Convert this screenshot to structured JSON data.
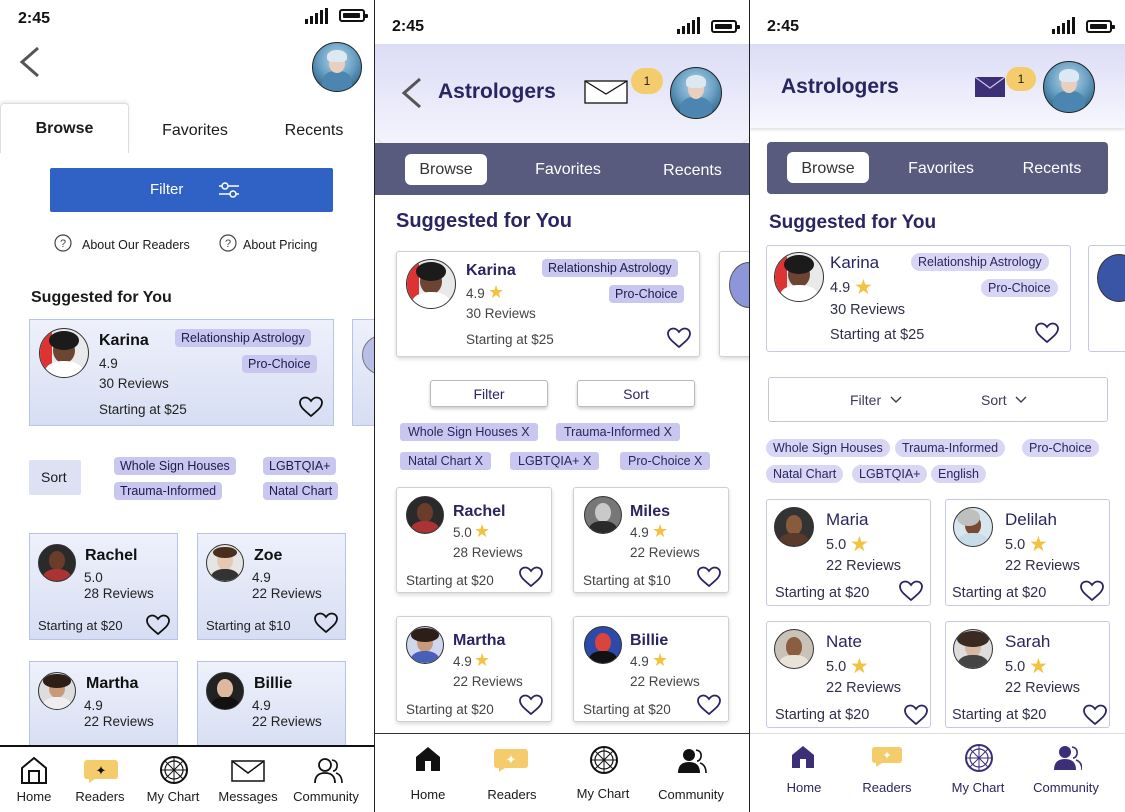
{
  "status": {
    "time": "2:45"
  },
  "screen1": {
    "tabs": [
      "Browse",
      "Favorites",
      "Recents"
    ],
    "filter_label": "Filter",
    "about_readers": "About Our Readers",
    "about_pricing": "About Pricing",
    "section_title": "Suggested for You",
    "featured": {
      "name": "Karina",
      "rating": "4.9",
      "reviews": "30 Reviews",
      "price": "Starting at $25",
      "tags": [
        "Relationship Astrology",
        "Pro-Choice"
      ]
    },
    "sort_label": "Sort",
    "filter_tags": [
      "Whole Sign Houses",
      "LGBTQIA+",
      "Trauma-Informed",
      "Natal Chart"
    ],
    "readers": [
      {
        "name": "Rachel",
        "rating": "5.0",
        "reviews": "28 Reviews",
        "price": "Starting at $20"
      },
      {
        "name": "Zoe",
        "rating": "4.9",
        "reviews": "22 Reviews",
        "price": "Starting at $10"
      },
      {
        "name": "Martha",
        "rating": "4.9",
        "reviews": "22 Reviews",
        "price": ""
      },
      {
        "name": "Billie",
        "rating": "4.9",
        "reviews": "22 Reviews",
        "price": ""
      }
    ],
    "nav": [
      "Home",
      "Readers",
      "My Chart",
      "Messages",
      "Community"
    ]
  },
  "screen2": {
    "title": "Astrologers",
    "badge": "1",
    "tabs": [
      "Browse",
      "Favorites",
      "Recents"
    ],
    "section_title": "Suggested for You",
    "featured": {
      "name": "Karina",
      "rating": "4.9",
      "reviews": "30 Reviews",
      "price": "Starting at $25",
      "tags": [
        "Relationship Astrology",
        "Pro-Choice"
      ]
    },
    "filter_label": "Filter",
    "sort_label": "Sort",
    "filter_tags": [
      "Whole Sign Houses  X",
      "Trauma-Informed  X",
      "Natal Chart  X",
      "LGBTQIA+  X",
      "Pro-Choice  X"
    ],
    "readers": [
      {
        "name": "Rachel",
        "rating": "5.0",
        "reviews": "28 Reviews",
        "price": "Starting at $20"
      },
      {
        "name": "Miles",
        "rating": "4.9",
        "reviews": "22 Reviews",
        "price": "Starting at $10"
      },
      {
        "name": "Martha",
        "rating": "4.9",
        "reviews": "22 Reviews",
        "price": "Starting at $20"
      },
      {
        "name": "Billie",
        "rating": "4.9",
        "reviews": "22 Reviews",
        "price": "Starting at $20"
      }
    ],
    "nav": [
      "Home",
      "Readers",
      "My Chart",
      "Community"
    ]
  },
  "screen3": {
    "title": "Astrologers",
    "badge": "1",
    "tabs": [
      "Browse",
      "Favorites",
      "Recents"
    ],
    "section_title": "Suggested for You",
    "featured": {
      "name": "Karina",
      "rating": "4.9",
      "reviews": "30 Reviews",
      "price": "Starting at $25",
      "tags": [
        "Relationship Astrology",
        "Pro-Choice"
      ]
    },
    "filter_label": "Filter",
    "sort_label": "Sort",
    "filter_tags": [
      "Whole Sign Houses",
      "Trauma-Informed",
      "Pro-Choice",
      "Natal Chart",
      "LGBTQIA+",
      "English"
    ],
    "readers": [
      {
        "name": "Maria",
        "rating": "5.0",
        "reviews": "22 Reviews",
        "price": "Starting at $20"
      },
      {
        "name": "Delilah",
        "rating": "5.0",
        "reviews": "22 Reviews",
        "price": "Starting at $20"
      },
      {
        "name": "Nate",
        "rating": "5.0",
        "reviews": "22 Reviews",
        "price": "Starting at $20"
      },
      {
        "name": "Sarah",
        "rating": "5.0",
        "reviews": "22 Reviews",
        "price": "Starting at $20"
      }
    ],
    "nav": [
      "Home",
      "Readers",
      "My Chart",
      "Community"
    ]
  },
  "colors": {
    "primary_blue": "#2f62c4",
    "purple_dark": "#2a2560",
    "purple_bar": "#585a7e",
    "lavender": "#c9c7ef",
    "badge_yellow": "#f5cc6b",
    "star": "#f3c23f"
  }
}
